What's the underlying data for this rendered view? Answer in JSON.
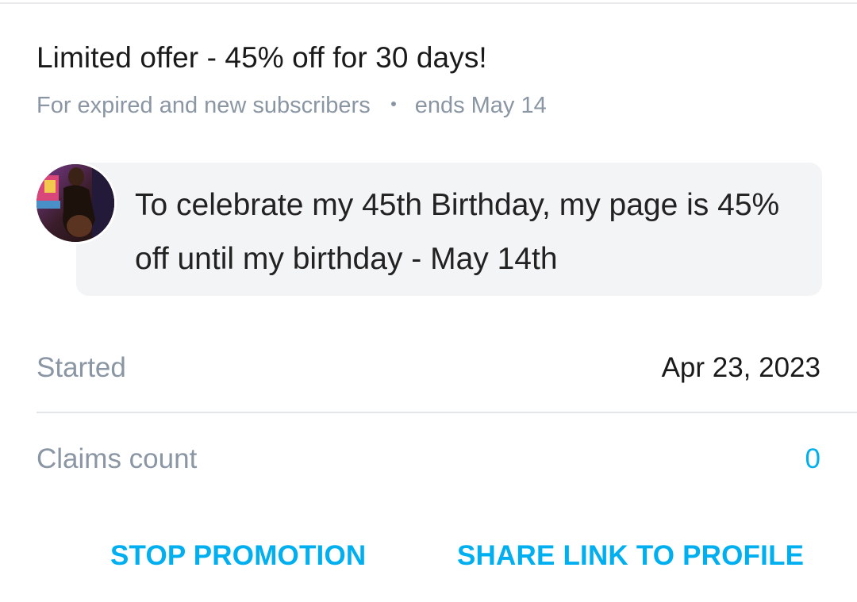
{
  "offer": {
    "title": "Limited offer - 45% off for 30 days!",
    "audience": "For expired and new subscribers",
    "ends": "ends May 14"
  },
  "message": {
    "text": "To celebrate my 45th Birthday, my page is 45% off until my birthday - May 14th"
  },
  "details": {
    "started_label": "Started",
    "started_value": "Apr 23, 2023",
    "claims_label": "Claims count",
    "claims_value": "0"
  },
  "actions": {
    "stop_label": "STOP PROMOTION",
    "share_label": "SHARE LINK TO PROFILE"
  },
  "colors": {
    "accent": "#00aff0",
    "muted": "#8a96a3",
    "bubble": "#f3f4f6"
  }
}
